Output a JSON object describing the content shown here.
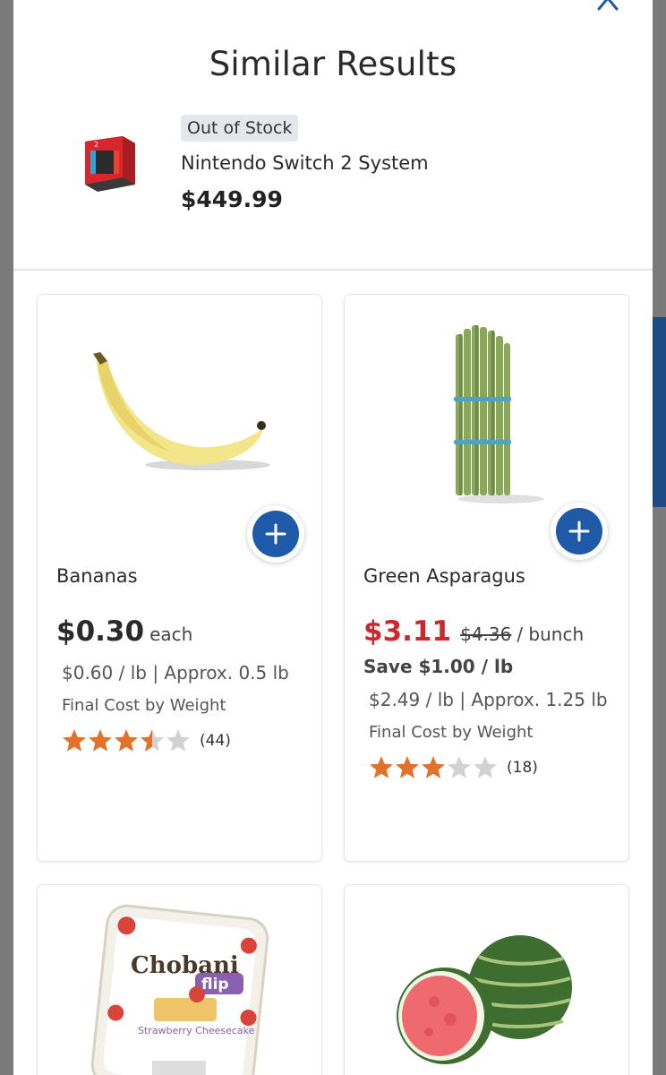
{
  "modal": {
    "title": "Similar Results"
  },
  "out_of_stock_item": {
    "badge": "Out of Stock",
    "name": "Nintendo Switch 2 System",
    "price": "$449.99"
  },
  "products": [
    {
      "name": "Bananas",
      "price": "$0.30",
      "unit": "each",
      "per_lb": "$0.60 / lb | Approx. 0.5 lb",
      "final_cost": "Final Cost by Weight",
      "rating": 3.5,
      "review_count": "(44)"
    },
    {
      "name": "Green Asparagus",
      "price": "$3.11",
      "was_price": "$4.36",
      "unit": "/ bunch",
      "save": "Save $1.00 / lb",
      "per_lb": "$2.49 / lb | Approx. 1.25 lb",
      "final_cost": "Final Cost by Weight",
      "rating": 3,
      "review_count": "(18)"
    },
    {
      "image_brand": "Chobani",
      "image_subbrand": "flip",
      "image_flavor": "Strawberry Cheesecake"
    },
    {}
  ],
  "colors": {
    "accent_blue": "#1e5aa8",
    "sale_red": "#c8282e",
    "star_orange": "#e2712a",
    "star_empty": "#d2d2d2"
  },
  "icons": {
    "close": "close-icon",
    "add": "plus-icon",
    "star": "star-icon"
  }
}
